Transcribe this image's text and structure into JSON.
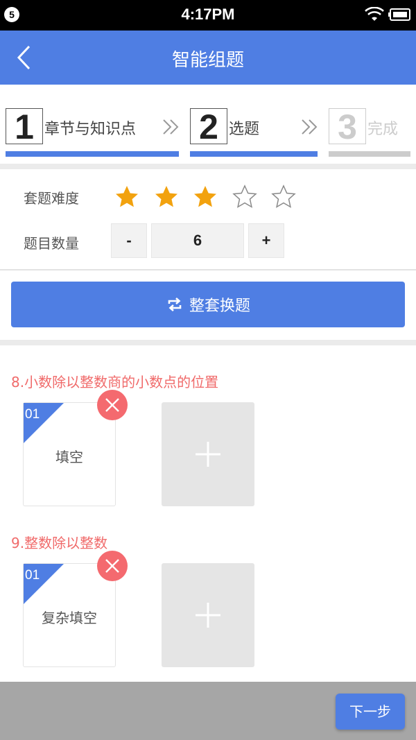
{
  "status_bar": {
    "badge": "5",
    "time": "4:17PM"
  },
  "nav": {
    "title": "智能组题"
  },
  "steps": [
    {
      "num": "1",
      "label": "章节与知识点",
      "state": "done"
    },
    {
      "num": "2",
      "label": "选题",
      "state": "current"
    },
    {
      "num": "3",
      "label": "完成",
      "state": "disabled"
    }
  ],
  "difficulty": {
    "label": "套题难度",
    "rating": 3,
    "max": 5
  },
  "quantity": {
    "label": "题目数量",
    "minus_label": "-",
    "value": "6",
    "plus_label": "+"
  },
  "swap_button": {
    "label": "整套换题"
  },
  "questions": [
    {
      "title": "8.小数除以整数商的小数点的位置",
      "card": {
        "index": "01",
        "type": "填空"
      }
    },
    {
      "title": "9.整数除以整数",
      "card": {
        "index": "01",
        "type": "复杂填空"
      }
    }
  ],
  "footer": {
    "next_label": "下一步"
  },
  "colors": {
    "primary": "#4f7ee3",
    "accent_red": "#f06a6a",
    "star": "#f2a20f",
    "disabled": "#cccccc"
  }
}
